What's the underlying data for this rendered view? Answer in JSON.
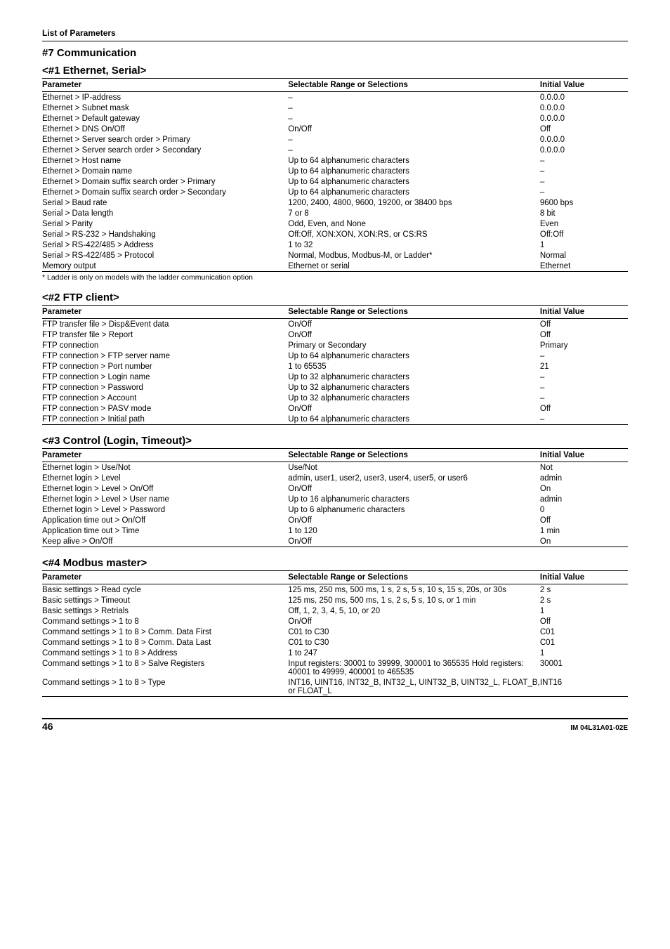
{
  "header": {
    "list_of_params": "List of Parameters"
  },
  "section7": {
    "title": "#7 Communication",
    "sub1": {
      "title": "<#1 Ethernet, Serial>",
      "headers": {
        "param": "Parameter",
        "range": "Selectable Range or Selections",
        "initial": "Initial Value"
      },
      "rows": [
        {
          "param": "Ethernet > IP-address",
          "range": "–",
          "initial": "0.0.0.0"
        },
        {
          "param": "Ethernet > Subnet mask",
          "range": "–",
          "initial": "0.0.0.0"
        },
        {
          "param": "Ethernet > Default gateway",
          "range": "–",
          "initial": "0.0.0.0"
        },
        {
          "param": "Ethernet > DNS On/Off",
          "range": "On/Off",
          "initial": "Off"
        },
        {
          "param": "Ethernet > Server search order > Primary",
          "range": "–",
          "initial": "0.0.0.0"
        },
        {
          "param": "Ethernet > Server search order > Secondary",
          "range": "–",
          "initial": "0.0.0.0"
        },
        {
          "param": "Ethernet > Host name",
          "range": "Up to 64 alphanumeric characters",
          "initial": "–"
        },
        {
          "param": "Ethernet > Domain name",
          "range": "Up to 64 alphanumeric characters",
          "initial": "–"
        },
        {
          "param": "Ethernet > Domain suffix search order > Primary",
          "range": "Up to 64 alphanumeric characters",
          "initial": "–"
        },
        {
          "param": "Ethernet > Domain suffix search order > Secondary",
          "range": "Up to 64 alphanumeric characters",
          "initial": "–"
        },
        {
          "param": "Serial > Baud rate",
          "range": "1200, 2400, 4800, 9600, 19200, or 38400 bps",
          "initial": "9600 bps"
        },
        {
          "param": "Serial > Data length",
          "range": "7 or 8",
          "initial": "8 bit"
        },
        {
          "param": "Serial > Parity",
          "range": "Odd, Even, and None",
          "initial": "Even"
        },
        {
          "param": "Serial > RS-232 > Handshaking",
          "range": "Off:Off, XON:XON, XON:RS, or CS:RS",
          "initial": "Off:Off"
        },
        {
          "param": "Serial > RS-422/485 > Address",
          "range": "1 to 32",
          "initial": "1"
        },
        {
          "param": "Serial > RS-422/485 > Protocol",
          "range": "Normal, Modbus, Modbus-M, or Ladder*",
          "initial": "Normal"
        },
        {
          "param": "Memory output",
          "range": "Ethernet or serial",
          "initial": "Ethernet"
        }
      ],
      "footnote": "* Ladder is only on models with the ladder communication option"
    },
    "sub2": {
      "title": "<#2 FTP client>",
      "headers": {
        "param": "Parameter",
        "range": "Selectable Range or Selections",
        "initial": "Initial Value"
      },
      "rows": [
        {
          "param": "FTP transfer file > Disp&Event data",
          "range": "On/Off",
          "initial": "Off"
        },
        {
          "param": "FTP transfer file > Report",
          "range": "On/Off",
          "initial": "Off"
        },
        {
          "param": "FTP connection",
          "range": "Primary or Secondary",
          "initial": "Primary"
        },
        {
          "param": "FTP connection > FTP server name",
          "range": "Up to 64 alphanumeric characters",
          "initial": "–"
        },
        {
          "param": "FTP connection > Port number",
          "range": "1 to 65535",
          "initial": "21"
        },
        {
          "param": "FTP connection > Login name",
          "range": "Up to 32 alphanumeric characters",
          "initial": "–"
        },
        {
          "param": "FTP connection > Password",
          "range": "Up to 32 alphanumeric characters",
          "initial": "–"
        },
        {
          "param": "FTP connection > Account",
          "range": "Up to 32 alphanumeric characters",
          "initial": "–"
        },
        {
          "param": "FTP connection > PASV mode",
          "range": "On/Off",
          "initial": "Off"
        },
        {
          "param": "FTP connection > Initial path",
          "range": "Up to 64 alphanumeric characters",
          "initial": "–"
        }
      ]
    },
    "sub3": {
      "title": "<#3 Control (Login, Timeout)>",
      "headers": {
        "param": "Parameter",
        "range": "Selectable Range or Selections",
        "initial": "Initial Value"
      },
      "rows": [
        {
          "param": "Ethernet login > Use/Not",
          "range": "Use/Not",
          "initial": "Not"
        },
        {
          "param": "Ethernet login > Level",
          "range": "admin, user1, user2, user3, user4, user5, or user6",
          "initial": "admin"
        },
        {
          "param": "Ethernet login > Level > On/Off",
          "range": "On/Off",
          "initial": "On"
        },
        {
          "param": "Ethernet login > Level > User name",
          "range": "Up to 16 alphanumeric characters",
          "initial": "admin"
        },
        {
          "param": "Ethernet login > Level > Password",
          "range": "Up to 6 alphanumeric characters",
          "initial": "0"
        },
        {
          "param": "Application time out > On/Off",
          "range": "On/Off",
          "initial": "Off"
        },
        {
          "param": "Application time out > Time",
          "range": "1 to 120",
          "initial": "1 min"
        },
        {
          "param": "Keep alive > On/Off",
          "range": "On/Off",
          "initial": "On"
        }
      ]
    },
    "sub4": {
      "title": "<#4 Modbus master>",
      "headers": {
        "param": "Parameter",
        "range": "Selectable Range or Selections",
        "initial": "Initial Value"
      },
      "rows": [
        {
          "param": "Basic settings > Read cycle",
          "range": "125 ms, 250 ms, 500 ms, 1 s, 2 s, 5 s, 10 s, 15 s, 20s, or 30s",
          "initial": "2 s"
        },
        {
          "param": "Basic settings > Timeout",
          "range": "125 ms, 250 ms, 500 ms, 1 s, 2 s, 5 s, 10 s, or 1 min",
          "initial": "2 s"
        },
        {
          "param": "Basic settings > Retrials",
          "range": "Off, 1, 2, 3, 4, 5, 10, or 20",
          "initial": "1"
        },
        {
          "param": "Command settings > 1 to 8",
          "range": "On/Off",
          "initial": "Off"
        },
        {
          "param": "Command settings > 1 to 8 > Comm. Data First",
          "range": "C01 to C30",
          "initial": "C01"
        },
        {
          "param": "Command settings > 1 to 8 > Comm. Data Last",
          "range": "C01 to C30",
          "initial": "C01"
        },
        {
          "param": "Command settings > 1 to 8 > Address",
          "range": "1 to 247",
          "initial": "1"
        },
        {
          "param": "Command settings > 1 to 8 > Salve Registers",
          "range": "Input registers: 30001 to 39999, 300001 to 365535 Hold registers: 40001 to 49999, 400001 to 465535",
          "initial": "30001"
        },
        {
          "param": "Command settings > 1 to 8 > Type",
          "range": "INT16, UINT16, INT32_B, INT32_L, UINT32_B, UINT32_L, FLOAT_B, or FLOAT_L",
          "initial": "INT16"
        }
      ]
    }
  },
  "footer": {
    "page": "46",
    "doc": "IM 04L31A01-02E"
  }
}
